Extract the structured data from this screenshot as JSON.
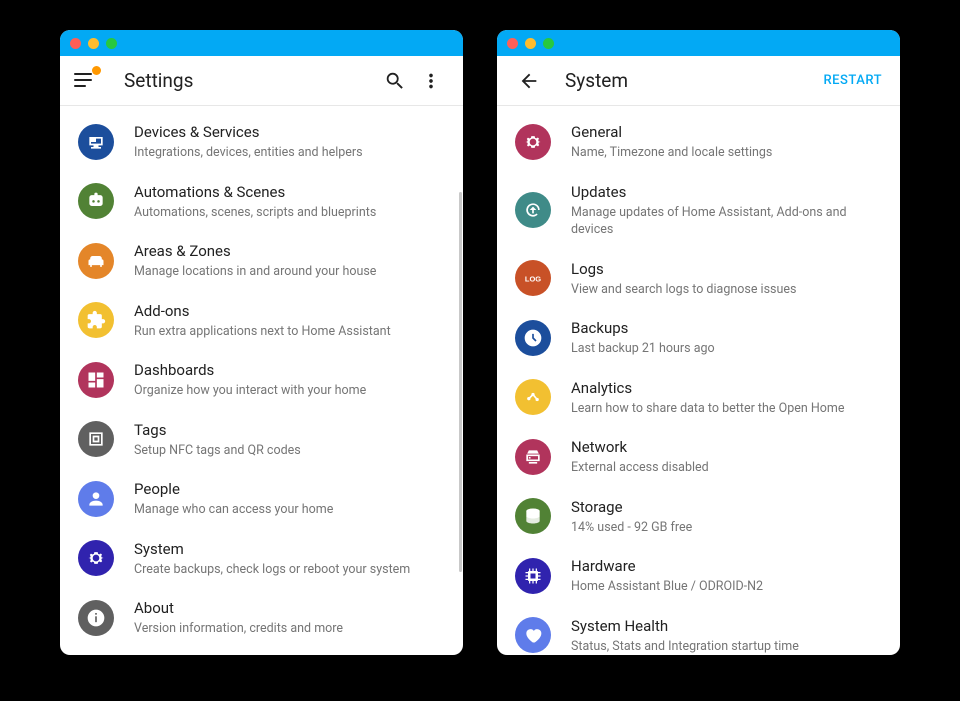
{
  "left": {
    "title": "Settings",
    "items": [
      {
        "title": "Devices & Services",
        "sub": "Integrations, devices, entities and helpers",
        "icon": "devices",
        "color": "#1c4e9c"
      },
      {
        "title": "Automations & Scenes",
        "sub": "Automations, scenes, scripts and blueprints",
        "icon": "robot",
        "color": "#518235"
      },
      {
        "title": "Areas & Zones",
        "sub": "Manage locations in and around your house",
        "icon": "sofa",
        "color": "#e48629"
      },
      {
        "title": "Add-ons",
        "sub": "Run extra applications next to Home Assistant",
        "icon": "puzzle",
        "color": "#f2c031"
      },
      {
        "title": "Dashboards",
        "sub": "Organize how you interact with your home",
        "icon": "dashboard",
        "color": "#b1345c"
      },
      {
        "title": "Tags",
        "sub": "Setup NFC tags and QR codes",
        "icon": "nfc",
        "color": "#606060"
      },
      {
        "title": "People",
        "sub": "Manage who can access your home",
        "icon": "person",
        "color": "#5f7cea"
      },
      {
        "title": "System",
        "sub": "Create backups, check logs or reboot your system",
        "icon": "cog",
        "color": "#3023ae"
      },
      {
        "title": "About",
        "sub": "Version information, credits and more",
        "icon": "info",
        "color": "#606060"
      }
    ]
  },
  "right": {
    "title": "System",
    "restart": "RESTART",
    "items": [
      {
        "title": "General",
        "sub": "Name, Timezone and locale settings",
        "icon": "cog",
        "color": "#b1345c"
      },
      {
        "title": "Updates",
        "sub": "Manage updates of Home Assistant, Add-ons and devices",
        "icon": "update",
        "color": "#3f8b88"
      },
      {
        "title": "Logs",
        "sub": "View and search logs to diagnose issues",
        "icon": "log",
        "color": "#c85127"
      },
      {
        "title": "Backups",
        "sub": "Last backup 21 hours ago",
        "icon": "backup",
        "color": "#1c4e9c"
      },
      {
        "title": "Analytics",
        "sub": "Learn how to share data to better the Open Home",
        "icon": "analytics",
        "color": "#f2c031"
      },
      {
        "title": "Network",
        "sub": "External access disabled",
        "icon": "network",
        "color": "#b1345c"
      },
      {
        "title": "Storage",
        "sub": "14% used - 92 GB free",
        "icon": "storage",
        "color": "#518235"
      },
      {
        "title": "Hardware",
        "sub": "Home Assistant Blue / ODROID-N2",
        "icon": "chip",
        "color": "#3023ae"
      },
      {
        "title": "System Health",
        "sub": "Status, Stats and Integration startup time",
        "icon": "heart",
        "color": "#5f7cea"
      }
    ]
  }
}
